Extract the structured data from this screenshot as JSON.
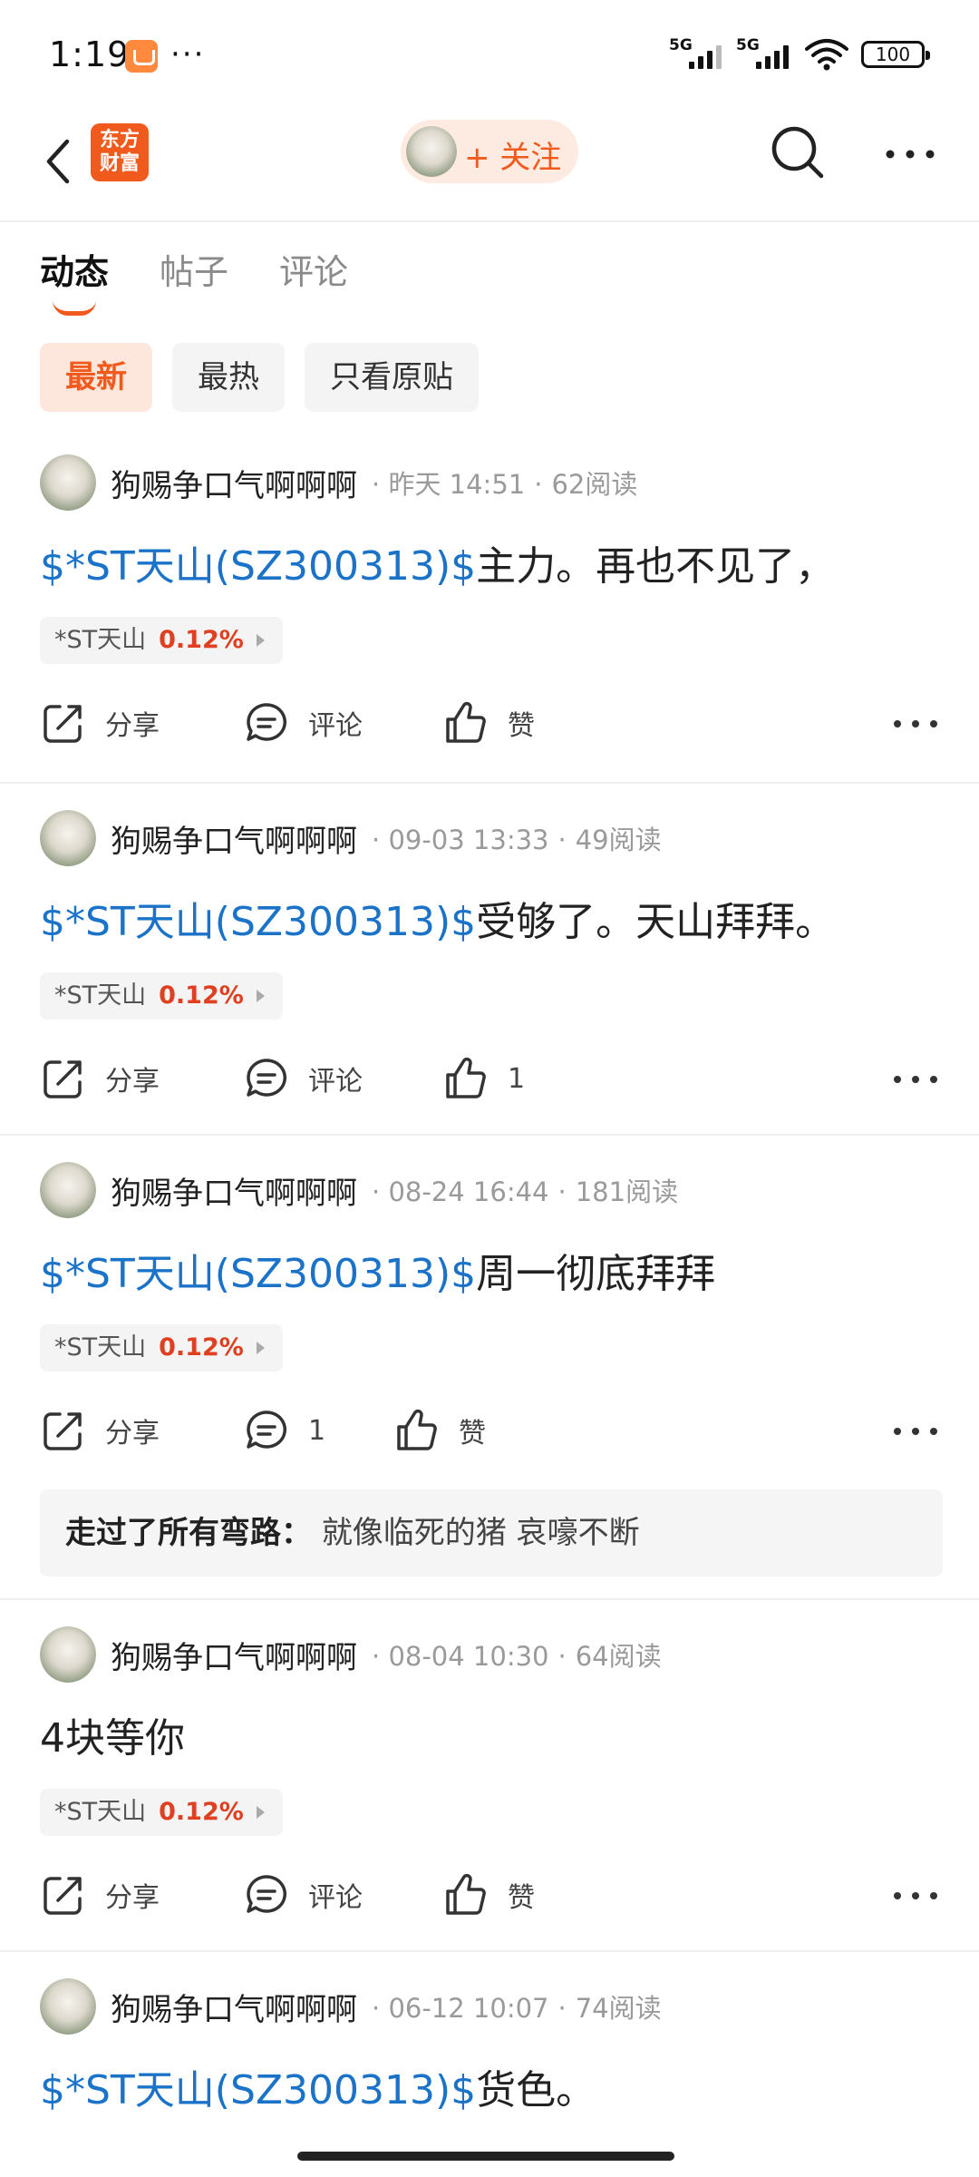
{
  "status_bar": {
    "time": "1:19",
    "more": "···",
    "net1": "5G",
    "net2": "5G",
    "battery": "100"
  },
  "nav": {
    "logo_line1": "东方",
    "logo_line2": "财富",
    "follow_label": "+ 关注"
  },
  "tabs": [
    {
      "label": "动态",
      "active": true
    },
    {
      "label": "帖子",
      "active": false
    },
    {
      "label": "评论",
      "active": false
    }
  ],
  "filters": [
    {
      "label": "最新",
      "active": true
    },
    {
      "label": "最热",
      "active": false
    },
    {
      "label": "只看原贴",
      "active": false
    }
  ],
  "colors": {
    "accent": "#f05a1c",
    "link": "#1a73c9",
    "up": "#e0401f"
  },
  "posts": [
    {
      "username": "狗赐争口气啊啊啊",
      "time": "昨天 14:51",
      "reads": "62阅读",
      "tag": "$*ST天山(SZ300313)$",
      "text": "主力。再也不见了，",
      "stock_name": "*ST天山",
      "stock_pct": "0.12%",
      "share": "分享",
      "comment": "评论",
      "like": "赞"
    },
    {
      "username": "狗赐争口气啊啊啊",
      "time": "09-03 13:33",
      "reads": "49阅读",
      "tag": "$*ST天山(SZ300313)$",
      "text": "受够了。天山拜拜。",
      "stock_name": "*ST天山",
      "stock_pct": "0.12%",
      "share": "分享",
      "comment": "评论",
      "like": "1"
    },
    {
      "username": "狗赐争口气啊啊啊",
      "time": "08-24 16:44",
      "reads": "181阅读",
      "tag": "$*ST天山(SZ300313)$",
      "text": "周一彻底拜拜",
      "stock_name": "*ST天山",
      "stock_pct": "0.12%",
      "share": "分享",
      "comment": "1",
      "like": "赞",
      "reply_name": "走过了所有弯路：",
      "reply_text": "就像临死的猪 哀嚎不断"
    },
    {
      "username": "狗赐争口气啊啊啊",
      "time": "08-04 10:30",
      "reads": "64阅读",
      "text": "4块等你",
      "stock_name": "*ST天山",
      "stock_pct": "0.12%",
      "share": "分享",
      "comment": "评论",
      "like": "赞"
    },
    {
      "username": "狗赐争口气啊啊啊",
      "time": "06-12 10:07",
      "reads": "74阅读",
      "tag": "$*ST天山(SZ300313)$",
      "text": "货色。"
    }
  ]
}
